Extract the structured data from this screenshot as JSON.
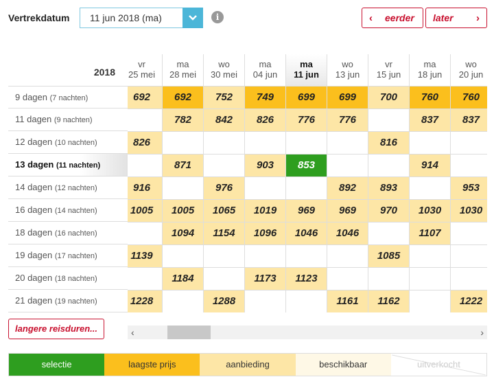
{
  "topbar": {
    "departure_label": "Vertrekdatum",
    "selected_date": "11 jun 2018 (ma)",
    "prev_label": "eerder",
    "next_label": "later"
  },
  "grid": {
    "year": "2018",
    "columns": [
      {
        "day": "vr",
        "date": "25 mei"
      },
      {
        "day": "ma",
        "date": "28 mei"
      },
      {
        "day": "wo",
        "date": "30 mei"
      },
      {
        "day": "ma",
        "date": "04 jun"
      },
      {
        "day": "ma",
        "date": "11 jun"
      },
      {
        "day": "wo",
        "date": "13 jun"
      },
      {
        "day": "vr",
        "date": "15 jun"
      },
      {
        "day": "ma",
        "date": "18 jun"
      },
      {
        "day": "wo",
        "date": "20 jun"
      }
    ],
    "selected_column": 4,
    "selected_row": 3,
    "rows": [
      {
        "label": "9 dagen",
        "nights": "(7 nachten)",
        "cells": [
          [
            "692",
            "offer"
          ],
          [
            "692",
            "lowest"
          ],
          [
            "752",
            "offer"
          ],
          [
            "749",
            "lowest"
          ],
          [
            "699",
            "lowest"
          ],
          [
            "699",
            "lowest"
          ],
          [
            "700",
            "offer"
          ],
          [
            "760",
            "lowest"
          ],
          [
            "760",
            "lowest"
          ]
        ]
      },
      {
        "label": "11 dagen",
        "nights": "(9 nachten)",
        "cells": [
          [
            "",
            "empty"
          ],
          [
            "782",
            "offer"
          ],
          [
            "842",
            "offer"
          ],
          [
            "826",
            "offer"
          ],
          [
            "776",
            "offer"
          ],
          [
            "776",
            "offer"
          ],
          [
            "",
            "empty"
          ],
          [
            "837",
            "offer"
          ],
          [
            "837",
            "offer"
          ]
        ]
      },
      {
        "label": "12 dagen",
        "nights": "(10 nachten)",
        "cells": [
          [
            "826",
            "offer"
          ],
          [
            "",
            "empty"
          ],
          [
            "",
            "empty"
          ],
          [
            "",
            "empty"
          ],
          [
            "",
            "empty"
          ],
          [
            "",
            "empty"
          ],
          [
            "816",
            "offer"
          ],
          [
            "",
            "empty"
          ],
          [
            "",
            "empty"
          ]
        ]
      },
      {
        "label": "13 dagen",
        "nights": "(11 nachten)",
        "cells": [
          [
            "",
            "empty"
          ],
          [
            "871",
            "offer"
          ],
          [
            "",
            "empty"
          ],
          [
            "903",
            "offer"
          ],
          [
            "853",
            "selection"
          ],
          [
            "",
            "empty"
          ],
          [
            "",
            "empty"
          ],
          [
            "914",
            "offer"
          ],
          [
            "",
            "empty"
          ]
        ]
      },
      {
        "label": "14 dagen",
        "nights": "(12 nachten)",
        "cells": [
          [
            "916",
            "offer"
          ],
          [
            "",
            "empty"
          ],
          [
            "976",
            "offer"
          ],
          [
            "",
            "empty"
          ],
          [
            "",
            "empty"
          ],
          [
            "892",
            "offer"
          ],
          [
            "893",
            "offer"
          ],
          [
            "",
            "empty"
          ],
          [
            "953",
            "offer"
          ]
        ]
      },
      {
        "label": "16 dagen",
        "nights": "(14 nachten)",
        "cells": [
          [
            "1005",
            "offer"
          ],
          [
            "1005",
            "offer"
          ],
          [
            "1065",
            "offer"
          ],
          [
            "1019",
            "offer"
          ],
          [
            "969",
            "offer"
          ],
          [
            "969",
            "offer"
          ],
          [
            "970",
            "offer"
          ],
          [
            "1030",
            "offer"
          ],
          [
            "1030",
            "offer"
          ]
        ]
      },
      {
        "label": "18 dagen",
        "nights": "(16 nachten)",
        "cells": [
          [
            "",
            "empty"
          ],
          [
            "1094",
            "offer"
          ],
          [
            "1154",
            "offer"
          ],
          [
            "1096",
            "offer"
          ],
          [
            "1046",
            "offer"
          ],
          [
            "1046",
            "offer"
          ],
          [
            "",
            "empty"
          ],
          [
            "1107",
            "offer"
          ],
          [
            "",
            "empty"
          ]
        ]
      },
      {
        "label": "19 dagen",
        "nights": "(17 nachten)",
        "cells": [
          [
            "1139",
            "offer"
          ],
          [
            "",
            "empty"
          ],
          [
            "",
            "empty"
          ],
          [
            "",
            "empty"
          ],
          [
            "",
            "empty"
          ],
          [
            "",
            "empty"
          ],
          [
            "1085",
            "offer"
          ],
          [
            "",
            "empty"
          ],
          [
            "",
            "empty"
          ]
        ]
      },
      {
        "label": "20 dagen",
        "nights": "(18 nachten)",
        "cells": [
          [
            "",
            "empty"
          ],
          [
            "1184",
            "offer"
          ],
          [
            "",
            "empty"
          ],
          [
            "1173",
            "offer"
          ],
          [
            "1123",
            "offer"
          ],
          [
            "",
            "empty"
          ],
          [
            "",
            "empty"
          ],
          [
            "",
            "empty"
          ],
          [
            "",
            "empty"
          ]
        ]
      },
      {
        "label": "21 dagen",
        "nights": "(19 nachten)",
        "cells": [
          [
            "1228",
            "offer"
          ],
          [
            "",
            "empty"
          ],
          [
            "1288",
            "offer"
          ],
          [
            "",
            "empty"
          ],
          [
            "",
            "empty"
          ],
          [
            "1161",
            "offer"
          ],
          [
            "1162",
            "offer"
          ],
          [
            "",
            "empty"
          ],
          [
            "1222",
            "offer"
          ]
        ]
      }
    ]
  },
  "longer_label": "langere reisduren...",
  "legend": [
    "selectie",
    "laagste prijs",
    "aanbieding",
    "beschikbaar",
    "uitverkocht"
  ],
  "colors": {
    "selection": "#2e9e1f",
    "lowest": "#fbbf1d",
    "offer": "#fde6a6",
    "available": "#fef8e6",
    "accent": "#c8102e",
    "dropdown": "#4cb6d8"
  }
}
